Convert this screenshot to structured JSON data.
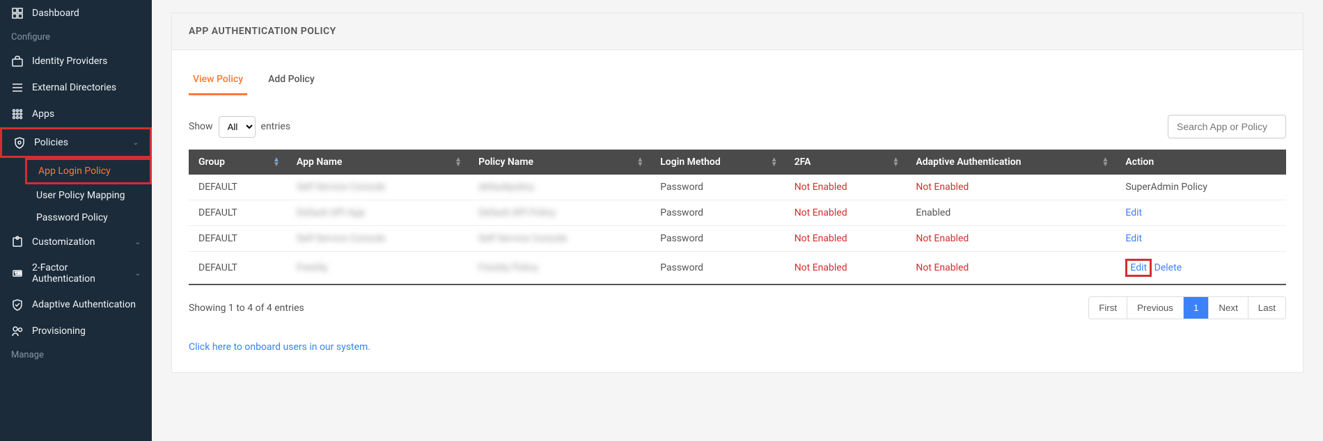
{
  "sidebar": {
    "items": [
      {
        "label": "Dashboard",
        "icon": "dashboard"
      },
      {
        "label": "Configure",
        "section": true
      },
      {
        "label": "Identity Providers",
        "icon": "briefcase"
      },
      {
        "label": "External Directories",
        "icon": "list"
      },
      {
        "label": "Apps",
        "icon": "grid"
      },
      {
        "label": "Policies",
        "icon": "shield",
        "expandable": true,
        "highlighted": true,
        "children": [
          {
            "label": "App Login Policy",
            "active": true,
            "highlighted": true
          },
          {
            "label": "User Policy Mapping"
          },
          {
            "label": "Password Policy"
          }
        ]
      },
      {
        "label": "Customization",
        "icon": "puzzle",
        "expandable": true
      },
      {
        "label": "2-Factor Authentication",
        "icon": "badge",
        "expandable": true
      },
      {
        "label": "Adaptive Authentication",
        "icon": "check-shield"
      },
      {
        "label": "Provisioning",
        "icon": "users"
      },
      {
        "label": "Manage",
        "section": true
      }
    ]
  },
  "page_title": "APP AUTHENTICATION POLICY",
  "tabs": [
    {
      "label": "View Policy",
      "active": true
    },
    {
      "label": "Add Policy"
    }
  ],
  "entries": {
    "show_label": "Show",
    "selected": "All",
    "after_label": "entries"
  },
  "search_placeholder": "Search App or Policy",
  "columns": [
    "Group",
    "App Name",
    "Policy Name",
    "Login Method",
    "2FA",
    "Adaptive Authentication",
    "Action"
  ],
  "rows": [
    {
      "group": "DEFAULT",
      "app": "Self Service Console",
      "policy": "defaultpolicy",
      "login": "Password",
      "twofa": "Not Enabled",
      "adaptive": "Not Enabled",
      "action_text": "SuperAdmin Policy",
      "action_type": "text"
    },
    {
      "group": "DEFAULT",
      "app": "Default API App",
      "policy": "Default API Policy",
      "login": "Password",
      "twofa": "Not Enabled",
      "adaptive": "Enabled",
      "action_text": "Edit",
      "action_type": "link"
    },
    {
      "group": "DEFAULT",
      "app": "Self Service Console",
      "policy": "Self Service Console",
      "login": "Password",
      "twofa": "Not Enabled",
      "adaptive": "Not Enabled",
      "action_text": "Edit",
      "action_type": "link"
    },
    {
      "group": "DEFAULT",
      "app": "Freshly",
      "policy": "Freshly Policy",
      "login": "Password",
      "twofa": "Not Enabled",
      "adaptive": "Not Enabled",
      "action_text": "Edit",
      "action_type": "link_highlight",
      "delete_text": "Delete"
    }
  ],
  "info_text": "Showing 1 to 4 of 4 entries",
  "pagination": [
    "First",
    "Previous",
    "1",
    "Next",
    "Last"
  ],
  "onboard_link": "Click here to onboard users in our system."
}
